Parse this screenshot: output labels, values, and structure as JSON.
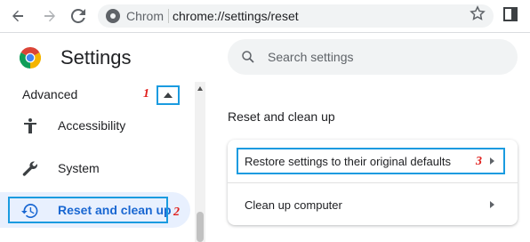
{
  "browser": {
    "omnibox_site_label": "Chrom",
    "omnibox_url": "chrome://settings/reset"
  },
  "header": {
    "title": "Settings",
    "search_placeholder": "Search settings"
  },
  "sidebar": {
    "advanced_label": "Advanced",
    "items": [
      {
        "label": "Accessibility",
        "icon": "accessibility-icon"
      },
      {
        "label": "System",
        "icon": "wrench-icon"
      },
      {
        "label": "Reset and clean up",
        "icon": "restore-icon",
        "active": true
      }
    ]
  },
  "main": {
    "section_title": "Reset and clean up",
    "rows": [
      {
        "label": "Restore settings to their original defaults"
      },
      {
        "label": "Clean up computer"
      }
    ]
  },
  "annotations": {
    "step1": "1",
    "step2": "2",
    "step3": "3"
  },
  "colors": {
    "accent": "#1a73e8",
    "annotation_box": "#1a9be0",
    "annotation_number": "#e0201d",
    "active_bg": "#e8f0fe"
  }
}
